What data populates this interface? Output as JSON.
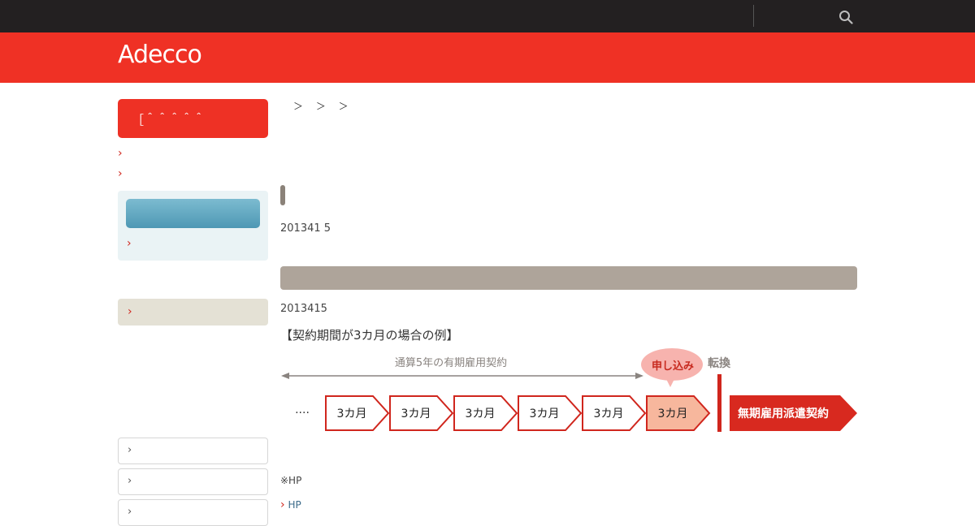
{
  "header": {
    "logo": "Adecco"
  },
  "sidebar": {
    "title": "［＾＾＾＾＾"
  },
  "breadcrumb": {
    "text": "＞ ＞ ＞"
  },
  "content": {
    "date1": "201341 5",
    "date2": "2013415",
    "diagram": {
      "title": "【契約期間が3カ月の場合の例】",
      "span_label": "通算5年の有期雇用契約",
      "apply_label": "申し込み",
      "convert_label": "転換",
      "ellipsis": "····",
      "period_labels": [
        "3カ月",
        "3カ月",
        "3カ月",
        "3カ月",
        "3カ月",
        "3カ月"
      ],
      "result_label": "無期雇用派遣契約"
    },
    "note": "※HP",
    "link": "HP"
  },
  "colors": {
    "brand_red": "#ef3125",
    "topbar": "#232021",
    "period_border": "#d0261d",
    "highlight_fill": "#f7b79d",
    "result_fill": "#d8291f",
    "grey_text": "#8a8480"
  }
}
